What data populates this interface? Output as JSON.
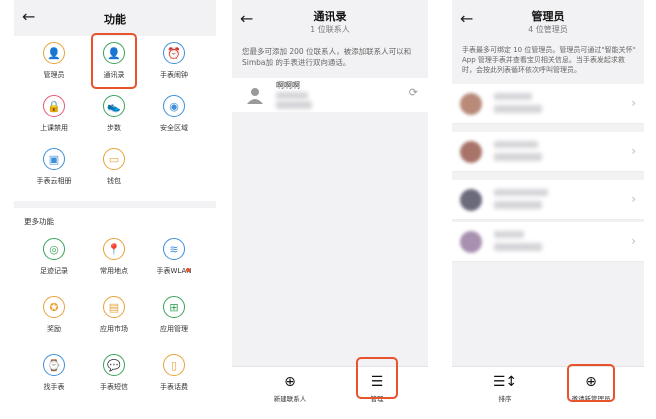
{
  "screen1": {
    "title": "功能",
    "features": [
      {
        "label": "管理员",
        "icon": "admin-icon",
        "glyph": "👤",
        "color": "#e8a23a"
      },
      {
        "label": "通讯录",
        "icon": "contacts-icon",
        "glyph": "👤",
        "color": "#3aa35a"
      },
      {
        "label": "手表闹钟",
        "icon": "alarm-icon",
        "glyph": "⏰",
        "color": "#3f8fd8"
      },
      {
        "label": "上课禁用",
        "icon": "class-disable-icon",
        "glyph": "🔒",
        "color": "#e65a78"
      },
      {
        "label": "步数",
        "icon": "steps-icon",
        "glyph": "👟",
        "color": "#3aa35a"
      },
      {
        "label": "安全区域",
        "icon": "safe-zone-icon",
        "glyph": "◉",
        "color": "#3f8fd8"
      },
      {
        "label": "手表云相册",
        "icon": "cloud-album-icon",
        "glyph": "▣",
        "color": "#3f8fd8"
      },
      {
        "label": "钱包",
        "icon": "wallet-icon",
        "glyph": "▭",
        "color": "#e8a23a"
      }
    ],
    "more_title": "更多功能",
    "more_features": [
      {
        "label": "足迹记录",
        "icon": "footprint-icon",
        "glyph": "◎",
        "color": "#3aa35a"
      },
      {
        "label": "常用地点",
        "icon": "location-icon",
        "glyph": "📍",
        "color": "#e8a23a"
      },
      {
        "label": "手表WLAN",
        "icon": "wlan-icon",
        "glyph": "≋",
        "color": "#3f8fd8"
      },
      {
        "label": "奖励",
        "icon": "reward-icon",
        "glyph": "✪",
        "color": "#e8a23a"
      },
      {
        "label": "应用市场",
        "icon": "app-market-icon",
        "glyph": "▤",
        "color": "#e8a23a"
      },
      {
        "label": "应用管理",
        "icon": "app-manage-icon",
        "glyph": "⊞",
        "color": "#3aa35a"
      },
      {
        "label": "找手表",
        "icon": "find-watch-icon",
        "glyph": "⌚",
        "color": "#3f8fd8"
      },
      {
        "label": "手表短信",
        "icon": "sms-icon",
        "glyph": "💬",
        "color": "#3aa35a"
      },
      {
        "label": "手表话费",
        "icon": "phone-bill-icon",
        "glyph": "▯",
        "color": "#e8a23a"
      }
    ]
  },
  "screen2": {
    "title": "通讯录",
    "subtitle": "1 位联系人",
    "note": "您最多可添加 200 位联系人，被添加联系人可以和 Simba加 的手表进行双向通话。",
    "contact_name": "啊啊啊",
    "add_label": "新建联系人",
    "manage_label": "管理"
  },
  "screen3": {
    "title": "管理员",
    "subtitle": "4 位管理员",
    "note": "手表最多可绑定 10 位管理员。管理员可通过\"智能关怀\" App 管理手表并查看宝贝相关信息。当手表发起求救时，会按此列表循环依次呼叫管理员。",
    "sort_label": "排序",
    "invite_label": "邀请新管理员"
  },
  "colors": {
    "accent": "#e8522c",
    "bg": "#f2f2f4"
  }
}
